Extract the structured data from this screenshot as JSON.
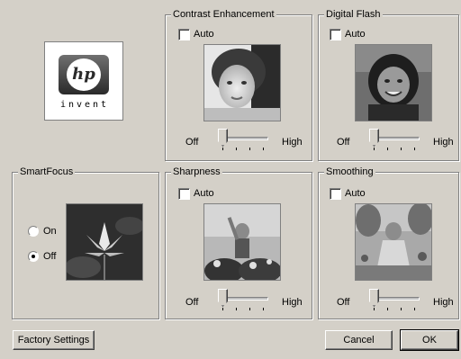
{
  "logo": {
    "mark": "hp",
    "word": "invent"
  },
  "groups": {
    "smartfocus": {
      "title": "SmartFocus",
      "options": [
        {
          "label": "On",
          "selected": false
        },
        {
          "label": "Off",
          "selected": true
        }
      ],
      "image": "lotus-flower"
    },
    "contrast": {
      "title": "Contrast Enhancement",
      "auto_label": "Auto",
      "auto_checked": false,
      "image": "child-portrait",
      "slider": {
        "min_label": "Off",
        "max_label": "High",
        "level": 0
      }
    },
    "flash": {
      "title": "Digital Flash",
      "auto_label": "Auto",
      "auto_checked": false,
      "image": "smiling-child-portrait",
      "slider": {
        "min_label": "Off",
        "max_label": "High",
        "level": 0
      }
    },
    "sharpness": {
      "title": "Sharpness",
      "auto_label": "Auto",
      "auto_checked": false,
      "image": "child-with-flowers",
      "slider": {
        "min_label": "Off",
        "max_label": "High",
        "level": 0
      }
    },
    "smoothing": {
      "title": "Smoothing",
      "auto_label": "Auto",
      "auto_checked": false,
      "image": "girl-in-garden",
      "slider": {
        "min_label": "Off",
        "max_label": "High",
        "level": 0
      }
    }
  },
  "buttons": {
    "factory": "Factory Settings",
    "cancel": "Cancel",
    "ok": "OK"
  }
}
